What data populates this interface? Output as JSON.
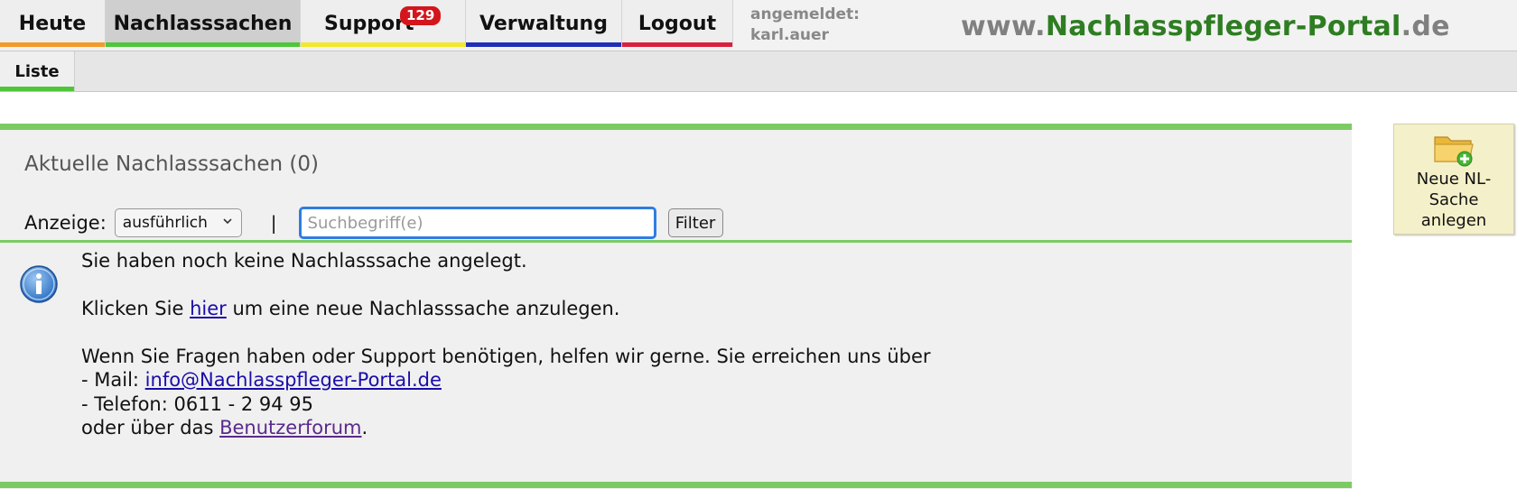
{
  "nav": {
    "tabs": [
      {
        "label": "Heute",
        "stripe_color": "#f39a2b"
      },
      {
        "label": "Nachlasssachen",
        "stripe_color": "#4fc63a",
        "active": true
      },
      {
        "label": "Support",
        "stripe_color": "#f2e72a",
        "badge": "129"
      },
      {
        "label": "Verwaltung",
        "stripe_color": "#1f2fb8"
      },
      {
        "label": "Logout",
        "stripe_color": "#d9203d"
      }
    ],
    "login_label": "angemeldet:",
    "login_user": "karl.auer"
  },
  "brand": {
    "prefix": "www.",
    "name": "Nachlasspfleger-Portal",
    "suffix": ".de"
  },
  "subnav": {
    "tabs": [
      {
        "label": "Liste",
        "active": true
      }
    ]
  },
  "main": {
    "title": "Aktuelle Nachlasssachen (0)",
    "display_label": "Anzeige:",
    "display_value": "ausführlich",
    "separator": "|",
    "search_placeholder": "Suchbegriff(e)",
    "filter_button": "Filter"
  },
  "info": {
    "line1": "Sie haben noch keine Nachlasssache angelegt.",
    "click_prefix": "Klicken Sie ",
    "click_link": "hier",
    "click_suffix": " um eine neue Nachlasssache anzulegen.",
    "support_line": "Wenn Sie Fragen haben oder Support benötigen, helfen wir gerne. Sie erreichen uns über",
    "mail_prefix": "- Mail: ",
    "mail_link": "info@Nachlasspfleger-Portal.de",
    "phone_line": "- Telefon: 0611 - 2 94 95",
    "forum_prefix": "oder über das ",
    "forum_link": "Benutzerforum",
    "forum_suffix": "."
  },
  "new_case_button": {
    "label": "Neue NL-Sache anlegen",
    "icon": "folder-add-icon"
  },
  "colors": {
    "accent_green": "#7bcb62",
    "brand_green": "#2e7d22",
    "badge_red": "#d4151c",
    "focus_blue": "#2f7de1"
  }
}
